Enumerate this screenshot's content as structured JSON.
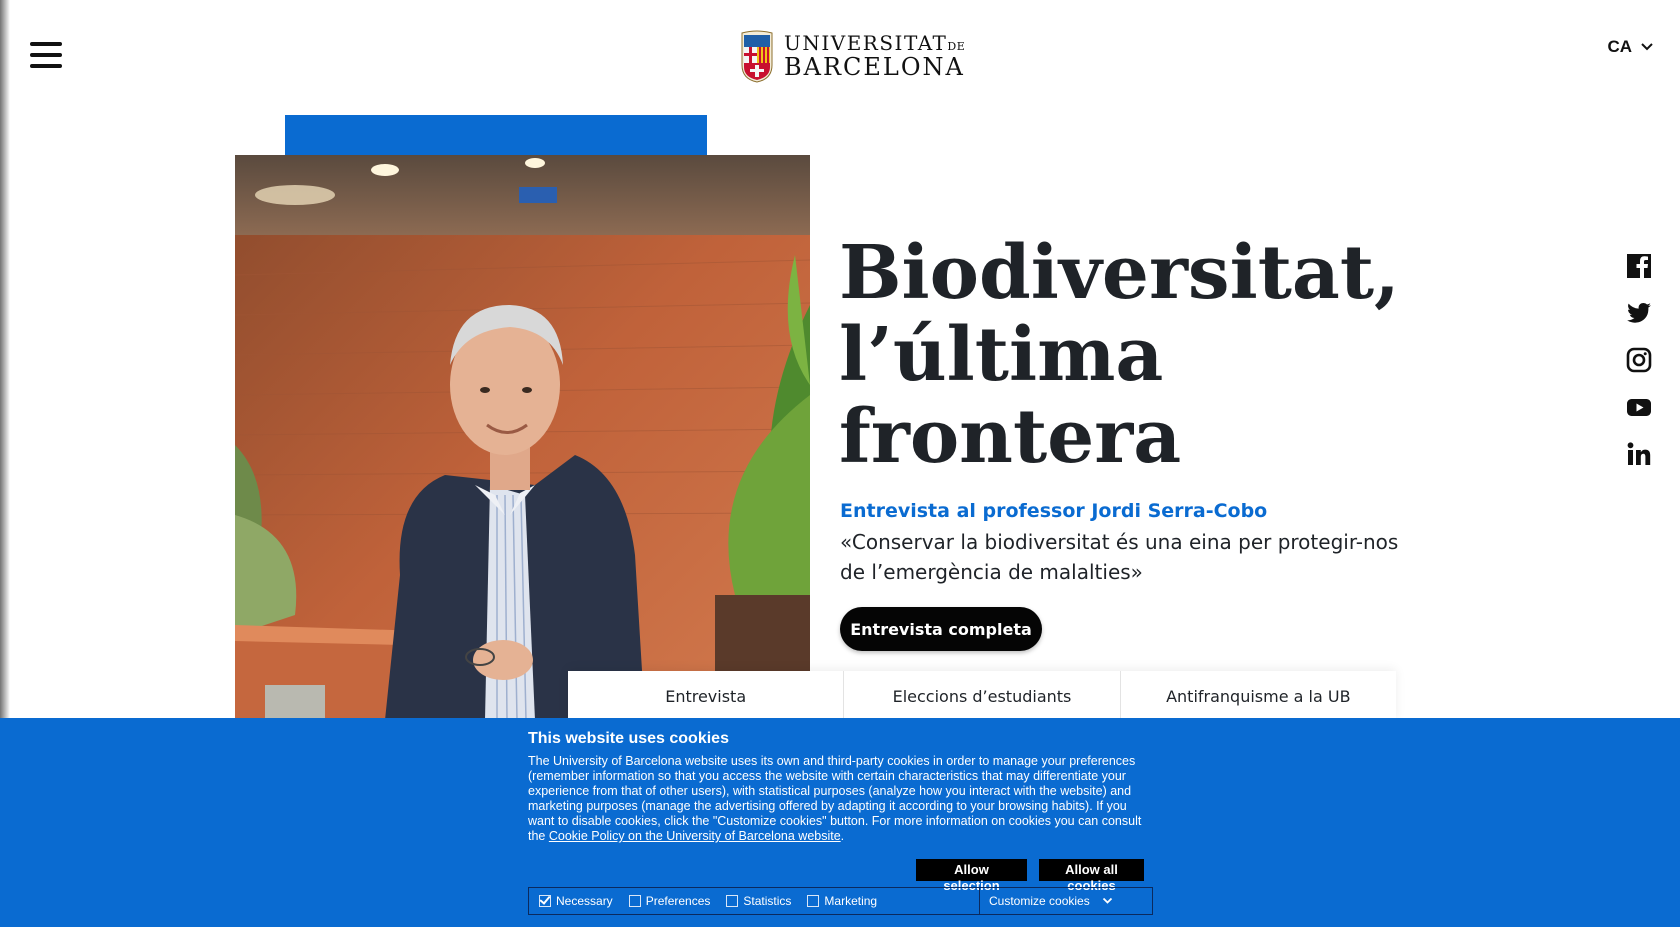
{
  "header": {
    "menu_icon": "hamburger-menu-icon",
    "logo": {
      "line1": "UNIVERSITAT",
      "line1_suffix": "DE",
      "line2": "BARCELONA"
    },
    "language": {
      "selected": "CA",
      "icon": "chevron-down-icon"
    }
  },
  "feature": {
    "title": "Biodiversitat, l’última frontera",
    "subtitle": "Entrevista al professor Jordi Serra-Cobo",
    "quote": "«Conservar la biodiversitat és una eina per protegir-nos de l’emergència de malalties»",
    "cta_label": "Entrevista completa"
  },
  "tabs": [
    {
      "label": "Entrevista"
    },
    {
      "label": "Eleccions d’estudiants"
    },
    {
      "label": "Antifranquisme a la UB"
    }
  ],
  "social": [
    "facebook-icon",
    "twitter-icon",
    "instagram-icon",
    "youtube-icon",
    "linkedin-icon"
  ],
  "cookies": {
    "title": "This website uses cookies",
    "body": "The University of Barcelona website uses its own and third-party cookies in order to manage your preferences (remember information so that you access the website with certain characteristics that may differentiate your experience from that of other users), with statistical purposes (analyze how you interact with the website) and marketing purposes (manage the advertising offered by adapting it according to your browsing habits). If you want to disable cookies, click the \"Customize cookies\" button. For more information on cookies you can consult the ",
    "link_text": "Cookie Policy on the University of Barcelona website",
    "body_end": ".",
    "allow_selection": "Allow selection",
    "allow_all": "Allow all cookies",
    "options": [
      {
        "label": "Necessary",
        "checked": true
      },
      {
        "label": "Preferences",
        "checked": false
      },
      {
        "label": "Statistics",
        "checked": false
      },
      {
        "label": "Marketing",
        "checked": false
      }
    ],
    "customize": "Customize cookies"
  },
  "colors": {
    "accent_blue": "#0a6bd1",
    "text_dark": "#1f2328",
    "button_black": "#050505"
  }
}
